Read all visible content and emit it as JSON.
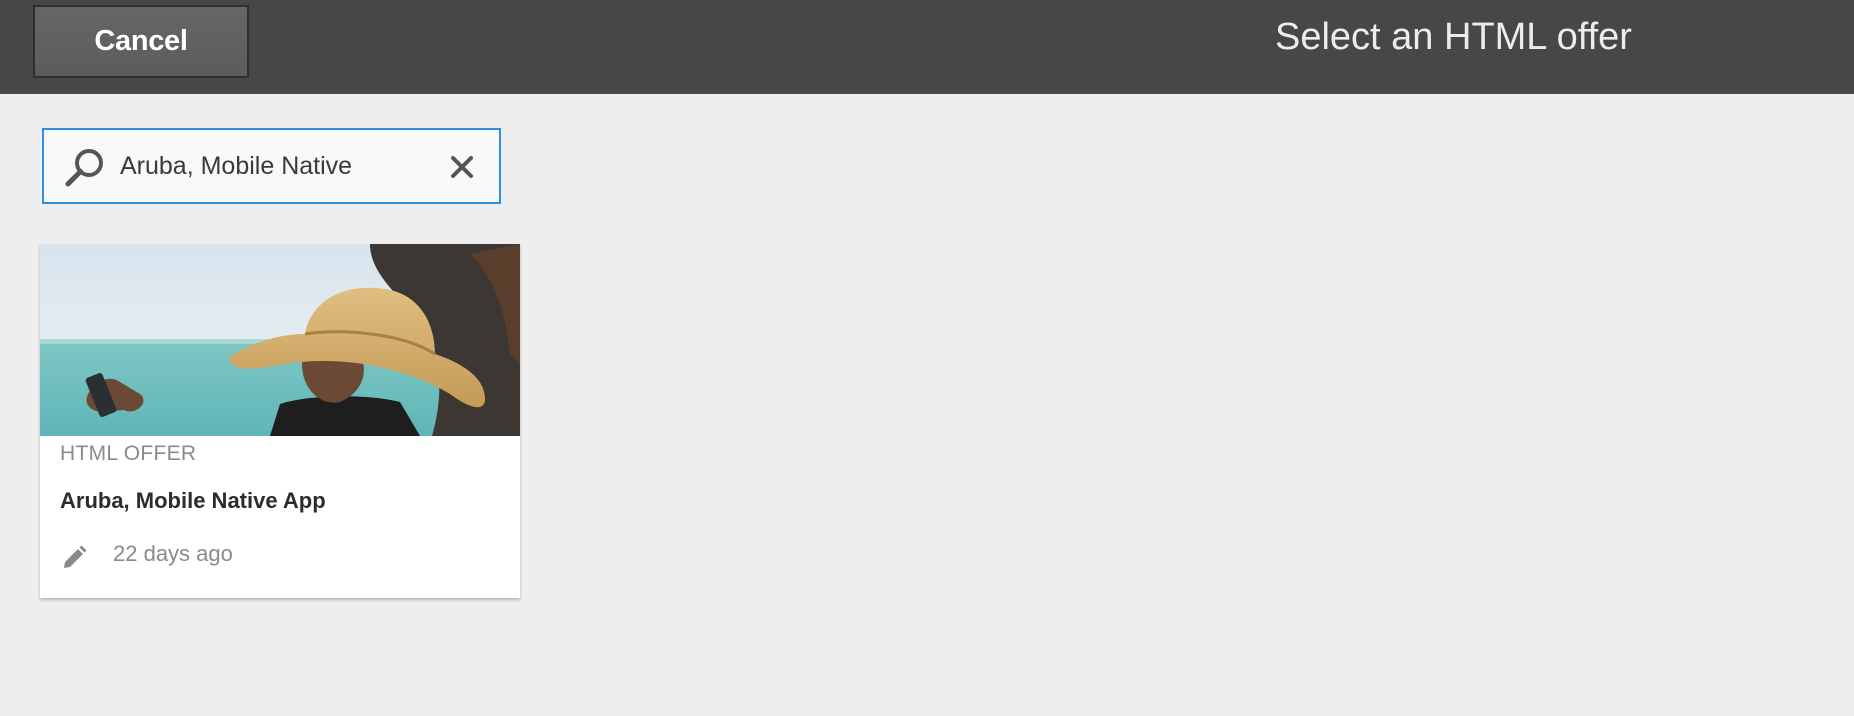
{
  "header": {
    "cancel_label": "Cancel",
    "title": "Select an HTML offer"
  },
  "search": {
    "value": "Aruba, Mobile Native",
    "icon": "search-icon",
    "clear_icon": "close-icon"
  },
  "results": [
    {
      "type_label": "HTML OFFER",
      "title": "Aruba, Mobile Native App",
      "modified": "22 days ago",
      "edit_icon": "pencil-icon"
    }
  ],
  "colors": {
    "header_bg": "#474747",
    "page_bg": "#eeeeee",
    "focus_border": "#2f8ee0"
  }
}
